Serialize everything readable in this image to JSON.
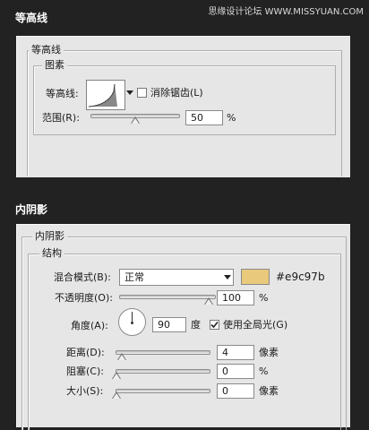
{
  "header": {
    "watermark": "思缘设计论坛 WWW.MISSYUAN.COM"
  },
  "contour_section": {
    "title": "等高线",
    "group_title": "等高线",
    "subgroup_title": "图素",
    "contour_label": "等高线:",
    "antialias_label": "消除锯齿(L)",
    "antialias_checked": false,
    "range_label": "范围(R):",
    "range_value": "50",
    "range_unit": "%"
  },
  "inner_shadow_section": {
    "title": "内阴影",
    "group_title": "内阴影",
    "subgroup_title": "结构",
    "blend_mode_label": "混合模式(B):",
    "blend_mode_value": "正常",
    "color_hex": "#e9c97b",
    "color_hex_label": "#e9c97b",
    "opacity_label": "不透明度(O):",
    "opacity_value": "100",
    "opacity_unit": "%",
    "angle_label": "角度(A):",
    "angle_value": "90",
    "angle_unit": "度",
    "global_light_label": "使用全局光(G)",
    "global_light_checked": true,
    "distance_label": "距离(D):",
    "distance_value": "4",
    "distance_unit": "像素",
    "choke_label": "阻塞(C):",
    "choke_value": "0",
    "choke_unit": "%",
    "size_label": "大小(S):",
    "size_value": "0",
    "size_unit": "像素"
  }
}
